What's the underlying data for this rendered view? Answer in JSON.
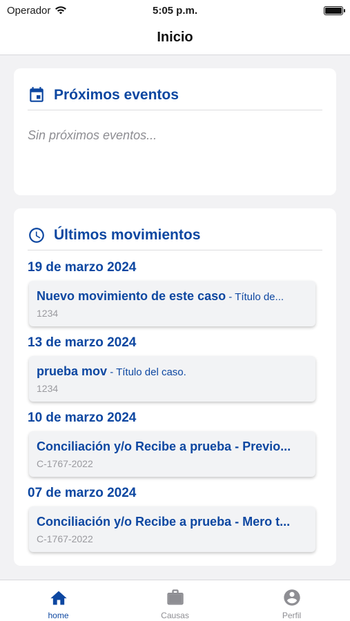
{
  "status_bar": {
    "carrier": "Operador",
    "time": "5:05 p.m."
  },
  "nav": {
    "title": "Inicio"
  },
  "events_card": {
    "title": "Próximos eventos",
    "empty_text": "Sin próximos eventos..."
  },
  "movements_card": {
    "title": "Últimos movimientos",
    "groups": [
      {
        "date": "19 de marzo 2024",
        "item": {
          "title": "Nuevo movimiento de este caso",
          "separator": " - ",
          "case_title": "Título de...",
          "code": "1234"
        }
      },
      {
        "date": "13 de marzo 2024",
        "item": {
          "title": "prueba mov",
          "separator": " - ",
          "case_title": "Título del caso.",
          "code": "1234"
        }
      },
      {
        "date": "10 de marzo 2024",
        "item": {
          "title": "Conciliación y/o Recibe a prueba - Previo...",
          "separator": "",
          "case_title": "",
          "code": "C-1767-2022"
        }
      },
      {
        "date": "07 de marzo 2024",
        "item": {
          "title": "Conciliación y/o Recibe a prueba - Mero t...",
          "separator": "",
          "case_title": "",
          "code": "C-1767-2022"
        }
      }
    ]
  },
  "tab_bar": {
    "tabs": [
      {
        "label": "home",
        "icon": "home-icon"
      },
      {
        "label": "Causas",
        "icon": "briefcase-icon"
      },
      {
        "label": "Perfil",
        "icon": "account-circle-icon"
      }
    ]
  },
  "colors": {
    "accent": "#0d47a1",
    "muted": "#8e8e93",
    "background": "#f2f2f4"
  }
}
